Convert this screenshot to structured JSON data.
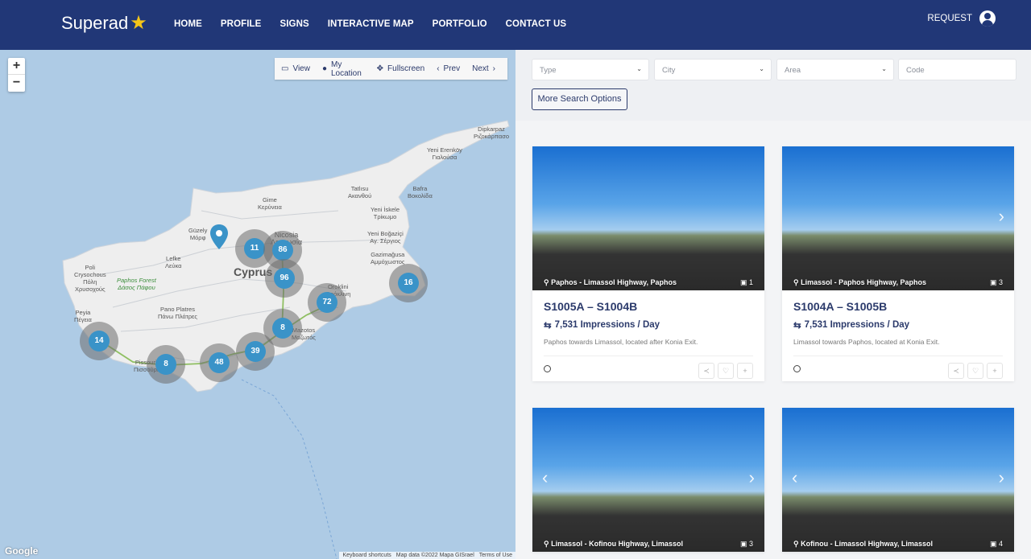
{
  "brand": {
    "name": "Superad",
    "star": "★"
  },
  "nav": {
    "items": [
      "HOME",
      "PROFILE",
      "SIGNS",
      "INTERACTIVE MAP",
      "PORTFOLIO",
      "CONTACT US"
    ],
    "request": "REQUEST"
  },
  "map": {
    "zoom_in": "+",
    "zoom_out": "−",
    "toolbar": {
      "view": "View",
      "my_location": "My Location",
      "fullscreen": "Fullscreen",
      "prev": "Prev",
      "next": "Next"
    },
    "country_label": "Cyprus",
    "place_labels": {
      "dipkarpaz": "Dipkarpaz\nΡιζοκάρπασο",
      "yeni_erenkoy": "Yeni Erenköy\nΓιαλούσα",
      "tatlisu": "Tatlısu\nΑκανθού",
      "bafra": "Bafra\nΒοκολίδα",
      "gime": "Gime\nΚερύνεια",
      "yeni_iskele": "Yeni İskele\nΤρίκωμο",
      "guzelyurt": "Güzely\nΜόρφ",
      "nicosia": "Nicosia\nΛευκωσία",
      "yeni_bogazici": "Yeni Boğaziçi\nΑγ. Σέργιος",
      "gazimagusa": "Gazimağusa\nΑμμόχωστος",
      "lefke": "Lefke\nΛεύκα",
      "poli": "Poli\nCrysochous\nΠόλη\nΧρυσοχούς",
      "paphos_forest": "Paphos Forest\nΔάσος Πάφου",
      "oroklini": "Oroklini\nΟρόκλινη",
      "agia": "Αγ. Νάπα",
      "pano_platres": "Pano Platres\nΠάνω Πλάτρες",
      "peyia": "Peyia\nΠέγεια",
      "mazotos": "Mazotos\nΜαζωτός",
      "pissouri": "Pissouri\nΠισσούρι",
      "limassol": "Λεμ."
    },
    "clusters": [
      {
        "count": "11"
      },
      {
        "count": "86"
      },
      {
        "count": "96"
      },
      {
        "count": "72"
      },
      {
        "count": "16"
      },
      {
        "count": "8"
      },
      {
        "count": "14"
      },
      {
        "count": "39"
      },
      {
        "count": "48"
      },
      {
        "count": "8"
      }
    ],
    "footer": {
      "shortcuts": "Keyboard shortcuts",
      "data": "Map data ©2022 Mapa GISrael",
      "terms": "Terms of Use"
    },
    "google": "Google"
  },
  "filters": {
    "type": "Type",
    "city": "City",
    "area": "Area",
    "code": "Code",
    "more": "More Search Options"
  },
  "cards": [
    {
      "location": "Paphos - Limassol Highway, Paphos",
      "photos": "1",
      "title": "S1005A – S1004B",
      "impressions": "7,531 Impressions / Day",
      "description": "Paphos towards Limassol, located after Konia Exit."
    },
    {
      "location": "Limassol - Paphos Highway, Paphos",
      "photos": "3",
      "title": "S1004A – S1005B",
      "impressions": "7,531 Impressions / Day",
      "description": "Limassol towards Paphos, located at Konia Exit."
    },
    {
      "location": "Limassol - Kofinou Highway, Limassol",
      "photos": "3"
    },
    {
      "location": "Kofinou - Limassol Highway, Limassol",
      "photos": "4"
    }
  ],
  "colors": {
    "header_bg": "#213777",
    "accent": "#2b3a6b",
    "cluster": "#3a93c8",
    "sea": "#aecbe5",
    "land": "#eeeeee"
  }
}
